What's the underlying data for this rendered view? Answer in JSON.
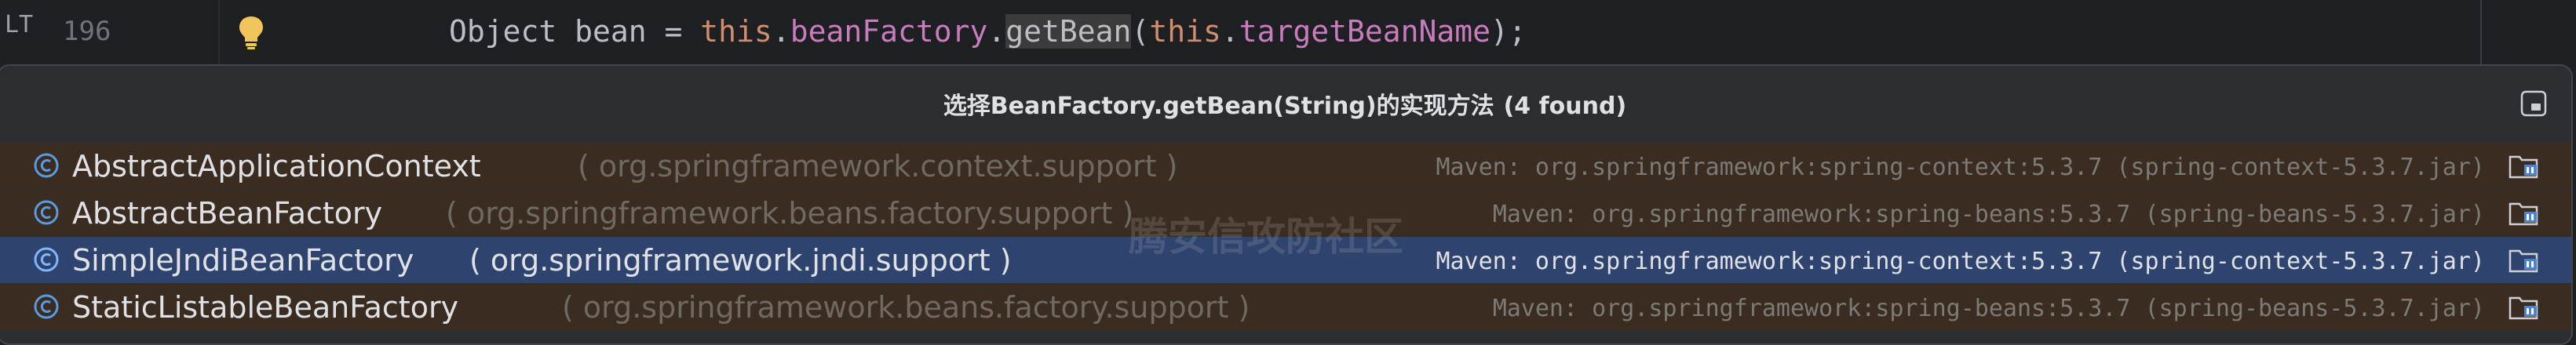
{
  "editor": {
    "gutter_marker": "LT",
    "line_number": "196",
    "code": {
      "indent_text": "Object bean = ",
      "this1": "this",
      "dot1": ".",
      "field1": "beanFactory",
      "dot2": ".",
      "method": "getBean",
      "paren_open": "(",
      "this2": "this",
      "dot3": ".",
      "field2": "targetBeanName",
      "tail": ");"
    }
  },
  "popup": {
    "title": "选择BeanFactory.getBean(String)的实现方法",
    "found": "(4 found)",
    "watermark": "腾安信攻防社区",
    "results": [
      {
        "class": "AbstractApplicationContext",
        "package": "( org.springframework.context.support )",
        "library": "Maven: org.springframework:spring-context:5.3.7 (spring-context-5.3.7.jar)",
        "selected": false
      },
      {
        "class": "AbstractBeanFactory",
        "package": "( org.springframework.beans.factory.support )",
        "library": "Maven: org.springframework:spring-beans:5.3.7 (spring-beans-5.3.7.jar)",
        "selected": false
      },
      {
        "class": "SimpleJndiBeanFactory",
        "package": "( org.springframework.jndi.support )",
        "library": "Maven: org.springframework:spring-context:5.3.7 (spring-context-5.3.7.jar)",
        "selected": true
      },
      {
        "class": "StaticListableBeanFactory",
        "package": "( org.springframework.beans.factory.support )",
        "library": "Maven: org.springframework:spring-beans:5.3.7 (spring-beans-5.3.7.jar)",
        "selected": false
      }
    ]
  },
  "colors": {
    "keyword": "#cf8e6d",
    "field": "#c77dbb",
    "row_background": "#3a2c20",
    "selected_row": "#2e436e",
    "class_icon": "#4a86c7"
  },
  "icons": {
    "gutter": "lightbulb-icon",
    "row": "class-icon",
    "library": "library-jar-icon",
    "popup_corner": "pin-window-icon"
  }
}
